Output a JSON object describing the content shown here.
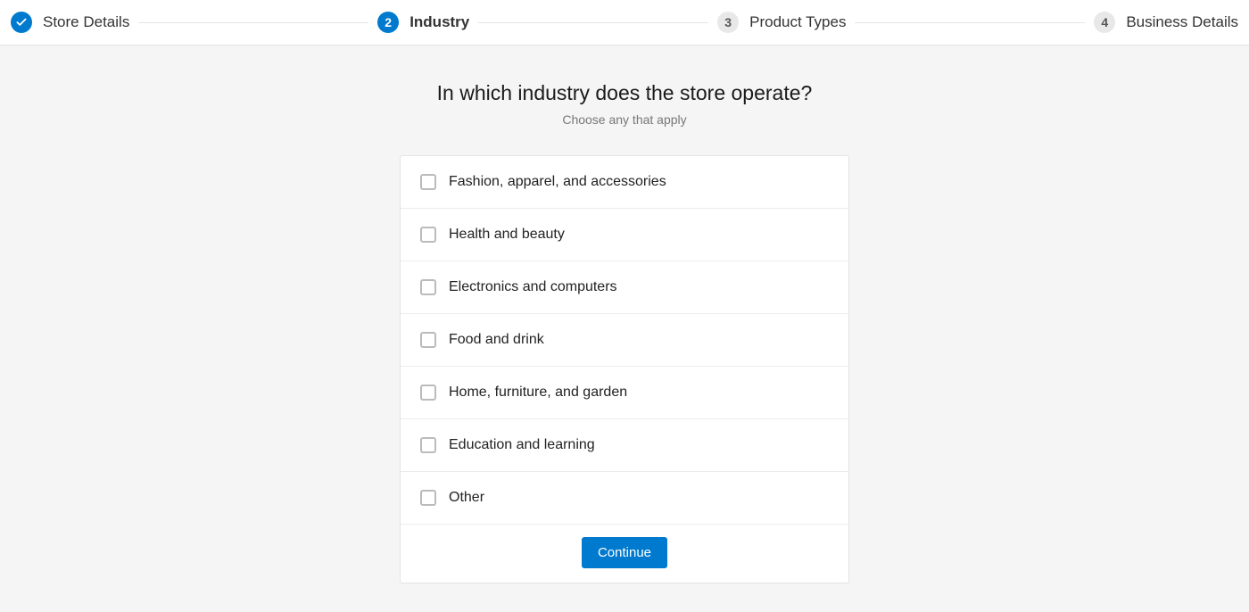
{
  "stepper": {
    "steps": [
      {
        "num": "",
        "label": "Store Details",
        "state": "done"
      },
      {
        "num": "2",
        "label": "Industry",
        "state": "current"
      },
      {
        "num": "3",
        "label": "Product Types",
        "state": "upcoming"
      },
      {
        "num": "4",
        "label": "Business Details",
        "state": "upcoming"
      }
    ]
  },
  "heading": "In which industry does the store operate?",
  "subheading": "Choose any that apply",
  "options": [
    "Fashion, apparel, and accessories",
    "Health and beauty",
    "Electronics and computers",
    "Food and drink",
    "Home, furniture, and garden",
    "Education and learning",
    "Other"
  ],
  "continue_label": "Continue",
  "colors": {
    "accent": "#007ace"
  }
}
